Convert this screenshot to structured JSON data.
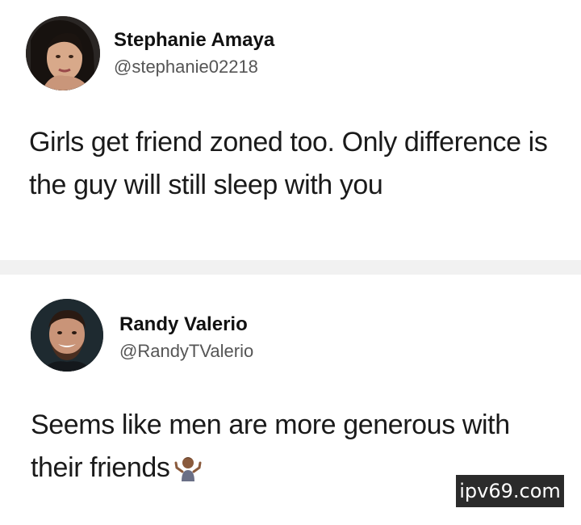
{
  "tweets": [
    {
      "name": "Stephanie Amaya",
      "handle": "@stephanie02218",
      "text": "Girls get friend zoned too. Only difference is the guy will still sleep with you",
      "avatar": "stephanie-avatar"
    },
    {
      "name": "Randy Valerio",
      "handle": "@RandyTValerio",
      "text": "Seems like men are more generous with their friends",
      "emoji": "person-shrugging-emoji",
      "avatar": "randy-avatar"
    }
  ],
  "watermark": "ipv69.com"
}
